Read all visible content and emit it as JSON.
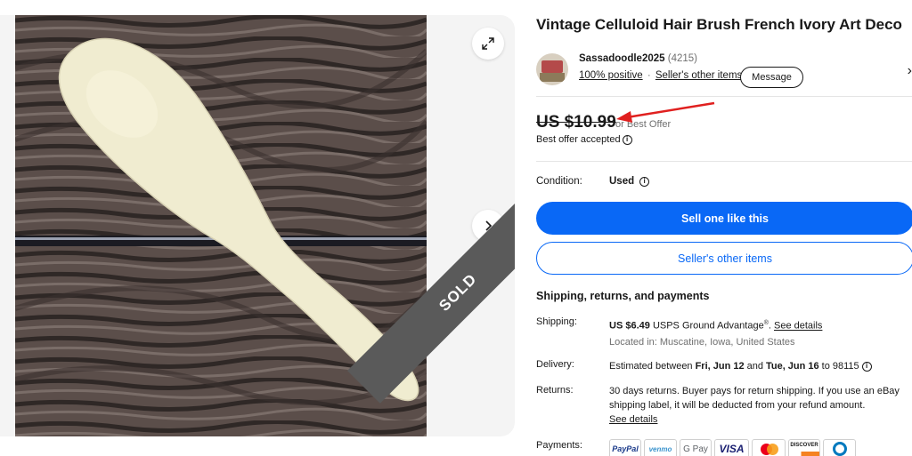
{
  "gallery": {
    "sold_label": "SOLD",
    "icons": {
      "expand": "expand-icon",
      "next": "chevron-right-icon"
    }
  },
  "listing": {
    "title": "Vintage Celluloid Hair Brush French Ivory Art Deco"
  },
  "seller": {
    "name": "Sassadoodle2025",
    "feedback_count": "(4215)",
    "positive": "100% positive",
    "separator": "·",
    "other_items_link": "Seller's other items",
    "message_button": "Message",
    "chevron": "›"
  },
  "price": {
    "amount": "US $10.99",
    "note": "or Best Offer",
    "offer_status": "Best offer accepted",
    "annotation_color": "#e0201f"
  },
  "condition": {
    "label": "Condition:",
    "value": "Used"
  },
  "actions": {
    "primary": "Sell one like this",
    "secondary": "Seller's other items",
    "accent_color": "#0968f6"
  },
  "shipping": {
    "heading": "Shipping, returns, and payments",
    "shipping_label": "Shipping:",
    "shipping_cost": "US $6.49",
    "shipping_service": "USPS Ground Advantage",
    "shipping_sup": "®",
    "shipping_sep": ".",
    "see_details": "See details",
    "location": "Located in: Muscatine, Iowa, United States",
    "delivery_label": "Delivery:",
    "delivery_prefix": "Estimated between",
    "delivery_start": "Fri, Jun 12",
    "delivery_and": "and",
    "delivery_end": "Tue, Jun 16",
    "delivery_to": "to 98115",
    "returns_label": "Returns:",
    "returns_text": "30 days returns. Buyer pays for return shipping. If you use an eBay shipping label, it will be deducted from your refund amount.",
    "returns_link": "See details",
    "payments_label": "Payments:",
    "payment_methods": [
      "PayPal",
      "venmo",
      "G Pay",
      "VISA",
      "Mastercard",
      "DISCOVER",
      "Diners Club"
    ]
  }
}
